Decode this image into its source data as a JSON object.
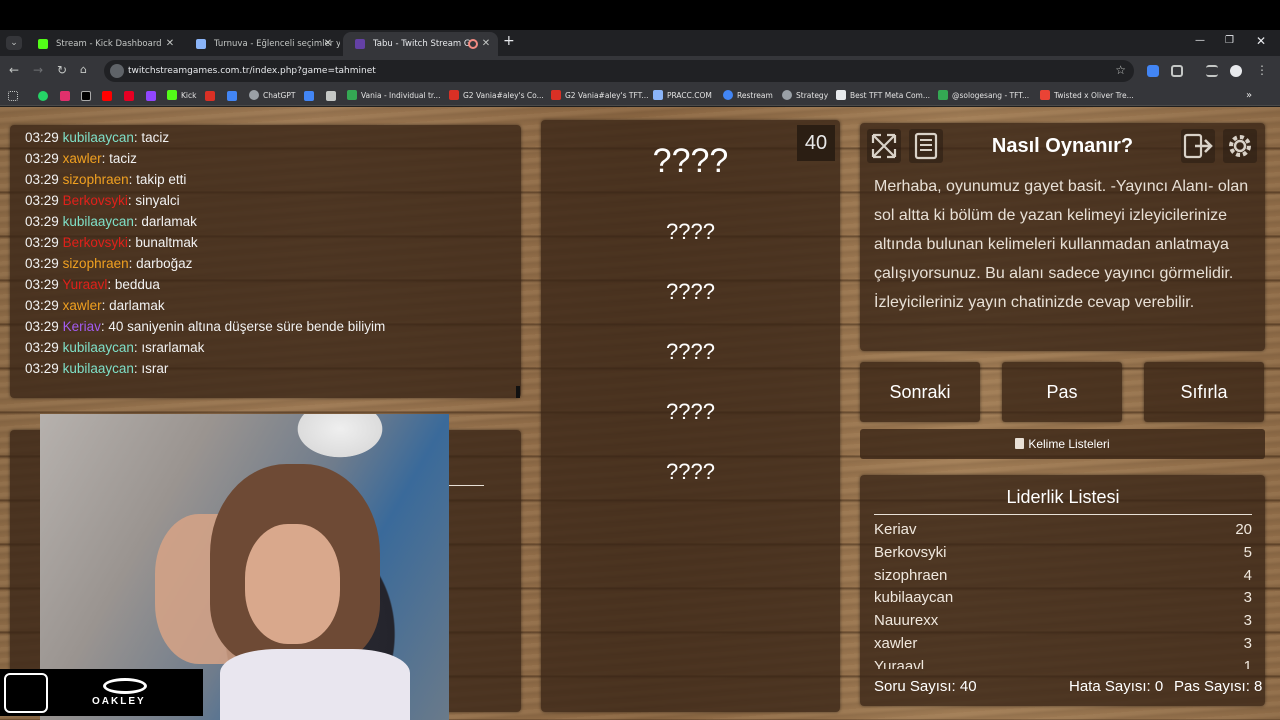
{
  "browser": {
    "tabs": [
      {
        "title": "Stream - Kick Dashboard",
        "favicon_color": "#53fc18",
        "active": false
      },
      {
        "title": "Turnuva - Eğlenceli seçimler yap",
        "favicon_color": "#8ab4f8",
        "active": false
      },
      {
        "title": "Tabu - Twitch Stream Games",
        "favicon_color": "#6441a5",
        "active": true
      }
    ],
    "url": "twitchstreamgames.com.tr/index.php?game=tahminet",
    "bookmarks": [
      {
        "label": "Kick",
        "color": "#53fc18"
      },
      {
        "label": "ChatGPT",
        "color": "#9aa0a6"
      },
      {
        "label": "Vania - Individual tr...",
        "color": "#34a853"
      },
      {
        "label": "G2 Vania#aley's Co...",
        "color": "#d93025"
      },
      {
        "label": "G2 Vania#aley's TFT...",
        "color": "#d93025"
      },
      {
        "label": "PRACC.COM",
        "color": "#8ab4f8"
      },
      {
        "label": "Restream",
        "color": "#4285f4"
      },
      {
        "label": "Strategy",
        "color": "#9aa0a6"
      },
      {
        "label": "Best TFT Meta Com...",
        "color": "#e8eaed"
      },
      {
        "label": "@sologesang - TFT...",
        "color": "#34a853"
      },
      {
        "label": "Twisted x Oliver Tre...",
        "color": "#ea4335"
      }
    ]
  },
  "chat": {
    "messages": [
      {
        "time": "03:29",
        "user": "kubilaaycan",
        "color": "#7fe0c8",
        "text": "taciz"
      },
      {
        "time": "03:29",
        "user": "xawler",
        "color": "#f0a020",
        "text": "taciz"
      },
      {
        "time": "03:29",
        "user": "sizophraen",
        "color": "#f0a020",
        "text": "takip etti"
      },
      {
        "time": "03:29",
        "user": "Berkovsyki",
        "color": "#e0201a",
        "text": "sinyalci"
      },
      {
        "time": "03:29",
        "user": "kubilaaycan",
        "color": "#7fe0c8",
        "text": "darlamak"
      },
      {
        "time": "03:29",
        "user": "Berkovsyki",
        "color": "#e0201a",
        "text": "bunaltmak"
      },
      {
        "time": "03:29",
        "user": "sizophraen",
        "color": "#f0a020",
        "text": "darboğaz"
      },
      {
        "time": "03:29",
        "user": "Yuraavl",
        "color": "#e0201a",
        "text": "beddua"
      },
      {
        "time": "03:29",
        "user": "xawler",
        "color": "#f0a020",
        "text": "darlamak"
      },
      {
        "time": "03:29",
        "user": "Keriav",
        "color": "#a35cf0",
        "text": "40 saniyenin altına düşerse süre bende biliyim"
      },
      {
        "time": "03:29",
        "user": "kubilaaycan",
        "color": "#7fe0c8",
        "text": "ısrarlamak"
      },
      {
        "time": "03:29",
        "user": "kubilaaycan",
        "color": "#7fe0c8",
        "text": "ısrar"
      }
    ]
  },
  "game": {
    "timer": "40",
    "main_word": "????",
    "forbidden_words": [
      "????",
      "????",
      "????",
      "????",
      "????"
    ]
  },
  "help": {
    "title": "Nasıl Oynanır?",
    "text": "Merhaba, oyunumuz gayet basit. -Yayıncı Alanı- olan sol altta ki bölüm de yazan kelimeyi izleyicilerinize altında bulunan kelimeleri kullanmadan anlatmaya çalışıyorsunuz. Bu alanı sadece yayıncı görmelidir. İzleyicileriniz yayın chatinizde cevap verebilir."
  },
  "actions": {
    "next": "Sonraki",
    "pass": "Pas",
    "reset": "Sıfırla",
    "word_lists": "Kelime Listeleri"
  },
  "leaderboard": {
    "title": "Liderlik Listesi",
    "rows": [
      {
        "name": "Keriav",
        "score": "20"
      },
      {
        "name": "Berkovsyki",
        "score": "5"
      },
      {
        "name": "sizophraen",
        "score": "4"
      },
      {
        "name": "kubilaaycan",
        "score": "3"
      },
      {
        "name": "Nauurexx",
        "score": "3"
      },
      {
        "name": "xawler",
        "score": "3"
      },
      {
        "name": "Yuraavl",
        "score": "1"
      }
    ]
  },
  "stats": {
    "questions": "Soru Sayısı: 40",
    "errors": "Hata Sayısı: 0",
    "passes": "Pas Sayısı: 8"
  },
  "overlay": {
    "sponsor": "OAKLEY"
  }
}
